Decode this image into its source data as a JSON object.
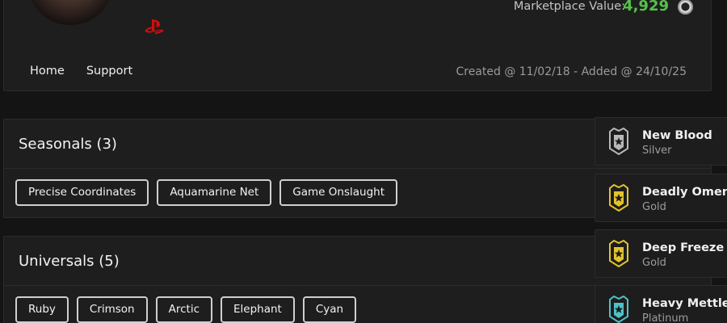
{
  "profile": {
    "marketplace_label": "Marketplace Value:",
    "marketplace_value": "4,929",
    "currency_icon": "coin-icon",
    "platform_icon": "playstation-icon",
    "platform_color": "#d10d0d",
    "value_color": "#56c14a",
    "created_text": "Created @ 11/02/18 - Added @ 24/10/25"
  },
  "nav": {
    "home": "Home",
    "support": "Support"
  },
  "sections": [
    {
      "title": "Seasonals (3)",
      "items": [
        "Precise Coordinates",
        "Aquamarine Net",
        "Game Onslaught"
      ]
    },
    {
      "title": "Universals (5)",
      "items": [
        "Ruby",
        "Crimson",
        "Arctic",
        "Elephant",
        "Cyan"
      ]
    }
  ],
  "ranks": [
    {
      "name": "New Blood",
      "tier": "Silver",
      "color": "#b8b8b8"
    },
    {
      "name": "Deadly Omen",
      "tier": "Gold",
      "color": "#e3c32c"
    },
    {
      "name": "Deep Freeze",
      "tier": "Gold",
      "color": "#e3c32c"
    },
    {
      "name": "Heavy Mettle",
      "tier": "Platinum",
      "color": "#4fc1c8"
    }
  ]
}
